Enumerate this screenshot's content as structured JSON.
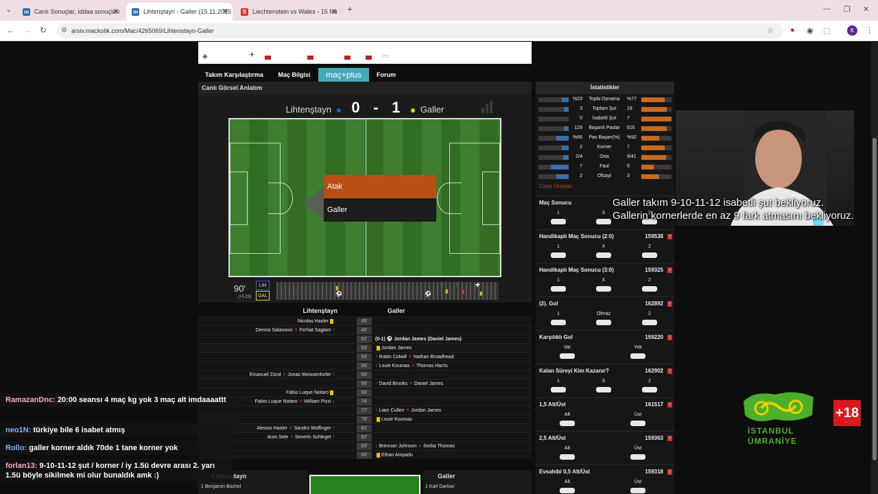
{
  "browser": {
    "tabs": [
      {
        "label": "Canlı Sonuçlar, iddaa sonuçları",
        "active": false
      },
      {
        "label": "Lihtenştayn - Galler (15.11.2025",
        "active": true
      },
      {
        "label": "Liechtenstein vs Wales - 15 No",
        "active": false
      }
    ],
    "url": "arsiv.mackolik.com/Mac/4265069/Lihtenstayn-Galler"
  },
  "nav": {
    "items": [
      "Takım Karşılaştırma",
      "Maç Bilgisi",
      "maç+plus",
      "Forum"
    ],
    "section_title": "Canlı Görsel Anlatım"
  },
  "scoreboard": {
    "home": "Lihtenştayn",
    "away": "Galler",
    "home_score": "0",
    "away_score": "1",
    "separator": "-",
    "home_dot": "#2a5fd4",
    "away_dot": "#e8d500"
  },
  "viz": {
    "attack_label": "Atak",
    "attack_team": "Galler",
    "minute": "90'",
    "minute_info": "(+5.23)",
    "home_tag": "LIH",
    "away_tag": "GAL"
  },
  "events": {
    "home": "Lihtenştayn",
    "away": "Galler",
    "rows": [
      {
        "min": "45'",
        "left": "Nicolas Hasler",
        "left_type": "card",
        "right": ""
      },
      {
        "min": "46'",
        "left": "Dennis Salanovic",
        "left_out": "Ferhat Saglam",
        "left_type": "sub",
        "right": ""
      },
      {
        "min": "61'",
        "left": "",
        "right": "(0-1)  ⚽ Jordan James (Daniel James)",
        "right_type": "goal"
      },
      {
        "min": "63'",
        "left": "",
        "right": "Jordan James",
        "right_type": "card"
      },
      {
        "min": "65'",
        "left": "",
        "right": "Rubin Colwill",
        "right_out": "Nathan Broadhead",
        "right_type": "sub"
      },
      {
        "min": "66'",
        "left": "",
        "right": "Louie Koumas",
        "right_out": "Thomas Harris",
        "right_type": "sub"
      },
      {
        "min": "66'",
        "left": "Emanuel Zünd",
        "left_out": "Jonas Weissenhofer",
        "left_type": "sub",
        "right": ""
      },
      {
        "min": "66'",
        "left": "",
        "right": "David Brooks",
        "right_out": "Daniel James",
        "right_type": "sub"
      },
      {
        "min": "68'",
        "left": "Fabio Luque Notaro",
        "left_type": "card",
        "right": ""
      },
      {
        "min": "74'",
        "left": "Fabio Luque Notaro",
        "left_out": "William Pizzi",
        "left_type": "sub",
        "right": ""
      },
      {
        "min": "77'",
        "left": "",
        "right": "Liam Cullen",
        "right_out": "Jordan James",
        "right_type": "sub"
      },
      {
        "min": "79'",
        "left": "",
        "right": "Louie Koumas",
        "right_type": "card"
      },
      {
        "min": "81'",
        "left": "Alessio Hasler",
        "left_out": "Sandro Wolfinger",
        "left_type": "sub",
        "right": ""
      },
      {
        "min": "82'",
        "left": "Aron Sele",
        "left_out": "Severin Schlegel",
        "left_type": "sub",
        "right": ""
      },
      {
        "min": "83'",
        "left": "",
        "right": "Brennan Johnson",
        "right_out": "Sorba Thomas",
        "right_type": "sub"
      },
      {
        "min": "86'",
        "left": "",
        "right": "Ethan Ampadu",
        "right_type": "card"
      }
    ]
  },
  "lineups": {
    "home_title": "Lihtenştayn",
    "away_title": "Galler",
    "home_first": "1   Benjamin Büchel",
    "away_first": "1   Karl Darlow"
  },
  "stats": {
    "title": "İstatistikler",
    "rows": [
      {
        "l": "%23",
        "label": "Topla Oynama",
        "r": "%77",
        "lp": 23,
        "rp": 77
      },
      {
        "l": "3",
        "label": "Toplam Şut",
        "r": "18",
        "lp": 15,
        "rp": 85
      },
      {
        "l": "0",
        "label": "İsabetli Şut",
        "r": "7",
        "lp": 0,
        "rp": 100
      },
      {
        "l": "129",
        "label": "Başarılı Paslar",
        "r": "616",
        "lp": 17,
        "rp": 83
      },
      {
        "l": "%66",
        "label": "Pas Başarı(%)",
        "r": "%92",
        "lp": 42,
        "rp": 58
      },
      {
        "l": "2",
        "label": "Korner",
        "r": "7",
        "lp": 22,
        "rp": 78
      },
      {
        "l": "2/4",
        "label": "Orta",
        "r": "9/41",
        "lp": 18,
        "rp": 82
      },
      {
        "l": "7",
        "label": "Faul",
        "r": "5",
        "lp": 58,
        "rp": 42
      },
      {
        "l": "2",
        "label": "Ofsayt",
        "r": "3",
        "lp": 40,
        "rp": 60
      }
    ],
    "live_odds_title": "Canlı Oranlar"
  },
  "odds": [
    {
      "title": "Maç Sonucu",
      "num": "",
      "labels": [
        "1",
        "X",
        "2"
      ]
    },
    {
      "title": "Handikaplı Maç Sonucu (2:0)",
      "num": "159538",
      "labels": [
        "1",
        "X",
        "2"
      ]
    },
    {
      "title": "Handikaplı Maç Sonucu (3:0)",
      "num": "159325",
      "labels": [
        "1",
        "X",
        "2"
      ]
    },
    {
      "title": "(2). Gol",
      "num": "162892",
      "labels": [
        "1",
        "Olmaz",
        "2"
      ]
    },
    {
      "title": "Karşılıklı Gol",
      "num": "159220",
      "labels": [
        "Var",
        "Yok"
      ]
    },
    {
      "title": "Kalan Süreyi Kim Kazanır?",
      "num": "162902",
      "labels": [
        "1",
        "X",
        "2"
      ]
    },
    {
      "title": "1,5 Alt/Üst",
      "num": "161517",
      "labels": [
        "Alt",
        "Üst"
      ]
    },
    {
      "title": "2,5 Alt/Üst",
      "num": "159363",
      "labels": [
        "Alt",
        "Üst"
      ]
    },
    {
      "title": "Evsahibi 0,5 Alt/Üst",
      "num": "159318",
      "labels": [
        "Alt",
        "Üst"
      ]
    }
  ],
  "overlay": {
    "line1": "Galler takım 9-10-11-12 isabetli şut bekliyoruz.",
    "line2": "Gallerin kornerlerde en az 9 fark atmasını bekliyoruz."
  },
  "chat": [
    {
      "user": "RamazanDnc:",
      "msg": "20:00 seansı 4 maç kg yok 3 maç alt imdaaaattt",
      "color": "pink"
    },
    {
      "user": "neo1N:",
      "msg": "türkiye bile 6 isabet atmış",
      "color": "blue"
    },
    {
      "user": "Rollo:",
      "msg": "galler korner aldık 70de 1 tane korner yok",
      "color": "blue"
    },
    {
      "user": "forlan13:",
      "msg": "9-10-11-12 şut / korner / iy 1.5ü devre arası 2. yarı 1.5ü böyle sikilmek mi olur bunaldık amk :)",
      "color": "pink"
    }
  ],
  "branding": {
    "logo_line1": "İSTANBUL",
    "logo_line2": "ÜMRANİYE",
    "age_badge": "+18"
  }
}
